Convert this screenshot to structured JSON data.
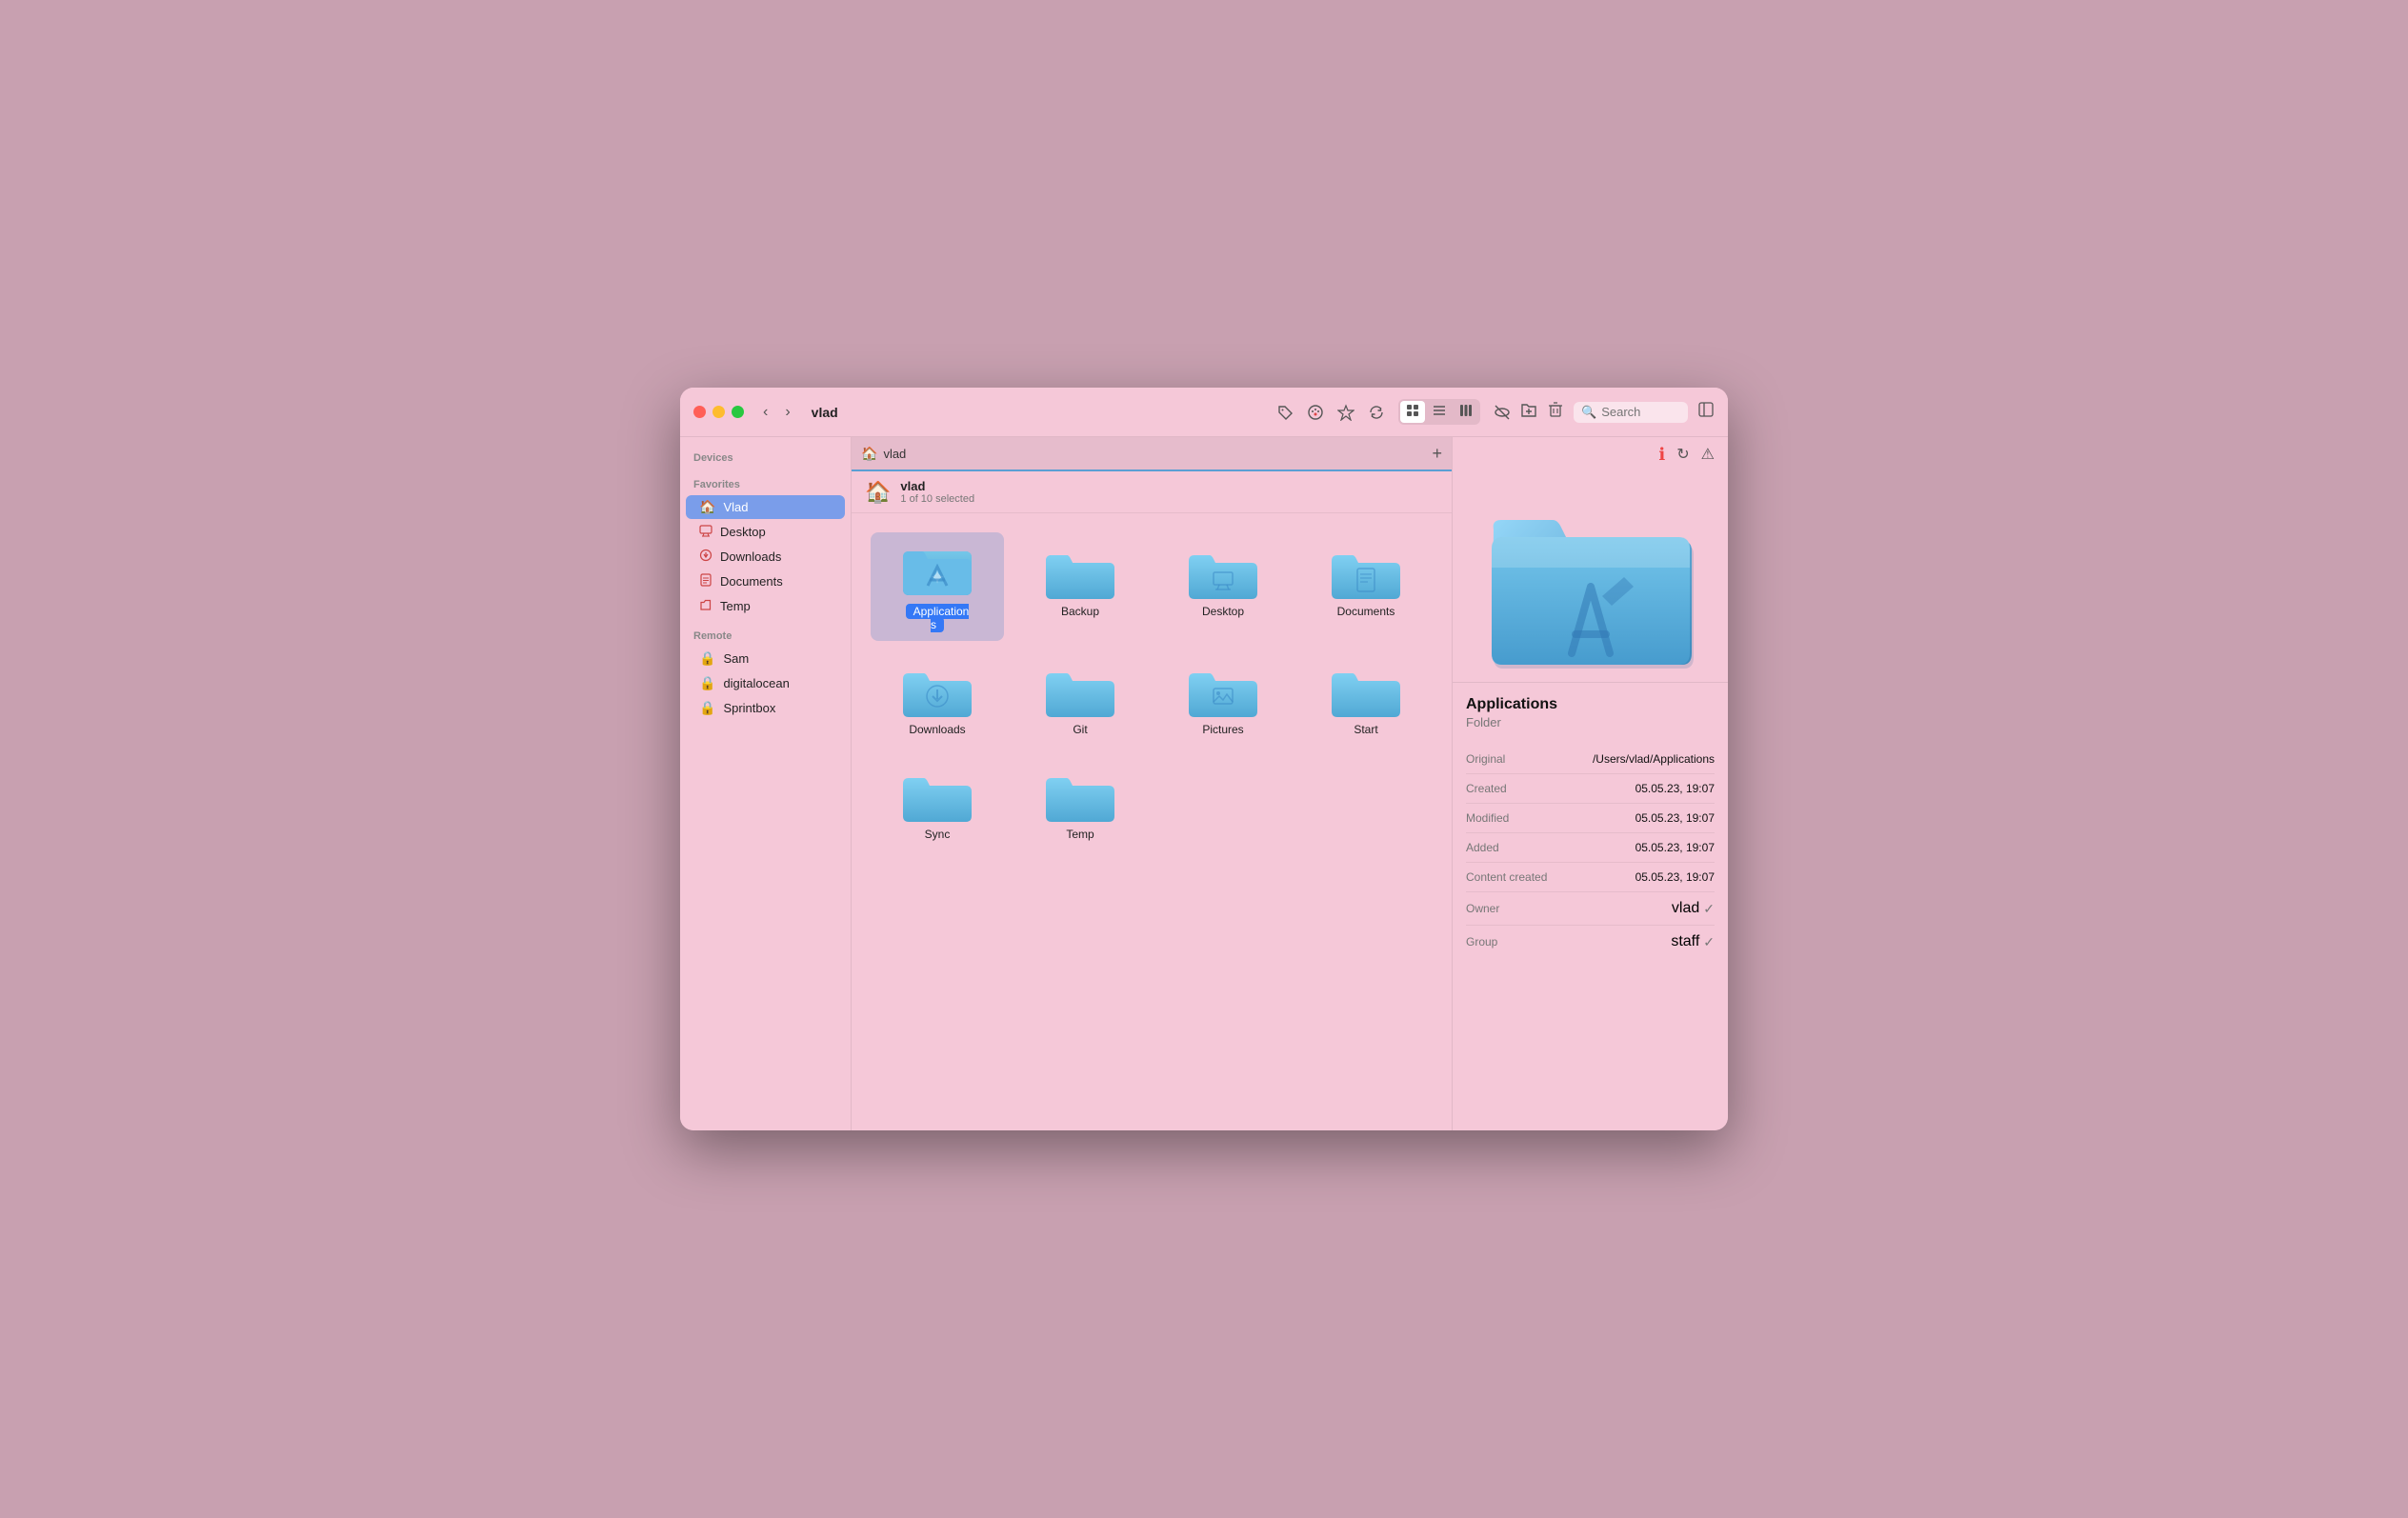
{
  "window": {
    "title": "vlad"
  },
  "titlebar": {
    "back_label": "‹",
    "forward_label": "›",
    "title": "vlad",
    "toolbar": {
      "tag_icon": "🏷",
      "palette_icon": "🎨",
      "star_icon": "★",
      "sync_icon": "↻",
      "search_placeholder": "Search",
      "search_icon": "🔍"
    }
  },
  "sidebar": {
    "sections": [
      {
        "title": "Devices",
        "items": []
      },
      {
        "title": "Favorites",
        "items": [
          {
            "label": "Vlad",
            "icon": "🏠",
            "active": true
          },
          {
            "label": "Desktop",
            "icon": "🖥"
          },
          {
            "label": "Downloads",
            "icon": "⊕"
          },
          {
            "label": "Documents",
            "icon": "📄"
          },
          {
            "label": "Temp",
            "icon": "📁"
          }
        ]
      },
      {
        "title": "Remote",
        "items": [
          {
            "label": "Sam",
            "icon": "🔒"
          },
          {
            "label": "digitalocean",
            "icon": "🔒"
          },
          {
            "label": "Sprintbox",
            "icon": "🔒"
          }
        ]
      }
    ]
  },
  "pathbar": {
    "icon": "🏠",
    "path": "vlad"
  },
  "folder_header": {
    "icon": "🏠",
    "name": "vlad",
    "info": "1 of 10 selected"
  },
  "files": [
    {
      "id": "applications",
      "label": "Applications",
      "selected": true,
      "icon_type": "app"
    },
    {
      "id": "backup",
      "label": "Backup",
      "selected": false,
      "icon_type": "plain"
    },
    {
      "id": "desktop",
      "label": "Desktop",
      "selected": false,
      "icon_type": "desktop"
    },
    {
      "id": "documents",
      "label": "Documents",
      "selected": false,
      "icon_type": "doc"
    },
    {
      "id": "downloads",
      "label": "Downloads",
      "selected": false,
      "icon_type": "download"
    },
    {
      "id": "git",
      "label": "Git",
      "selected": false,
      "icon_type": "plain"
    },
    {
      "id": "pictures",
      "label": "Pictures",
      "selected": false,
      "icon_type": "pictures"
    },
    {
      "id": "start",
      "label": "Start",
      "selected": false,
      "icon_type": "plain"
    },
    {
      "id": "sync",
      "label": "Sync",
      "selected": false,
      "icon_type": "plain"
    },
    {
      "id": "temp",
      "label": "Temp",
      "selected": false,
      "icon_type": "plain"
    }
  ],
  "inspector": {
    "title": "Applications",
    "subtitle": "Folder",
    "toolbar_icons": [
      "ℹ",
      "↻",
      "⚠"
    ],
    "details": [
      {
        "key": "Original",
        "value": "/Users/vlad/Applications"
      },
      {
        "key": "Created",
        "value": "05.05.23, 19:07"
      },
      {
        "key": "Modified",
        "value": "05.05.23, 19:07"
      },
      {
        "key": "Added",
        "value": "05.05.23, 19:07"
      },
      {
        "key": "Content created",
        "value": "05.05.23, 19:07"
      },
      {
        "key": "Owner",
        "value": "vlad",
        "has_icon": true
      },
      {
        "key": "Group",
        "value": "staff",
        "has_icon": true
      }
    ]
  }
}
